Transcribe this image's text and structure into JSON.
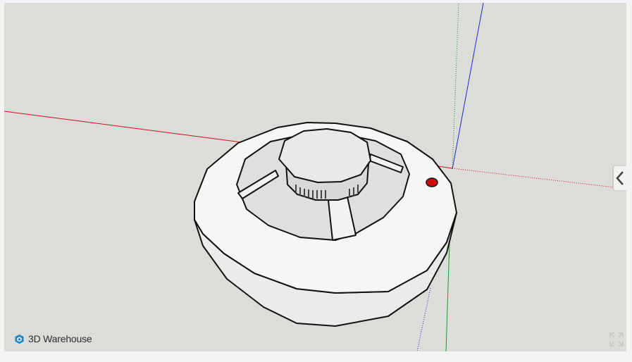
{
  "branding": {
    "logo_text": "3D Warehouse",
    "logo_icon": "3d-warehouse-logo-icon",
    "accent": "#1f86c8"
  },
  "viewer": {
    "background": "#dcdcd8",
    "model": "smoke-detector",
    "axes": {
      "x_color": "#c8141e",
      "y_color": "#1f9a2a",
      "z_color": "#1a2ccf"
    },
    "indicator_led_color": "#d10c0c"
  },
  "controls": {
    "side_panel_toggle_icon": "chevron-left-icon",
    "fullscreen_icon": "expand-icon"
  }
}
